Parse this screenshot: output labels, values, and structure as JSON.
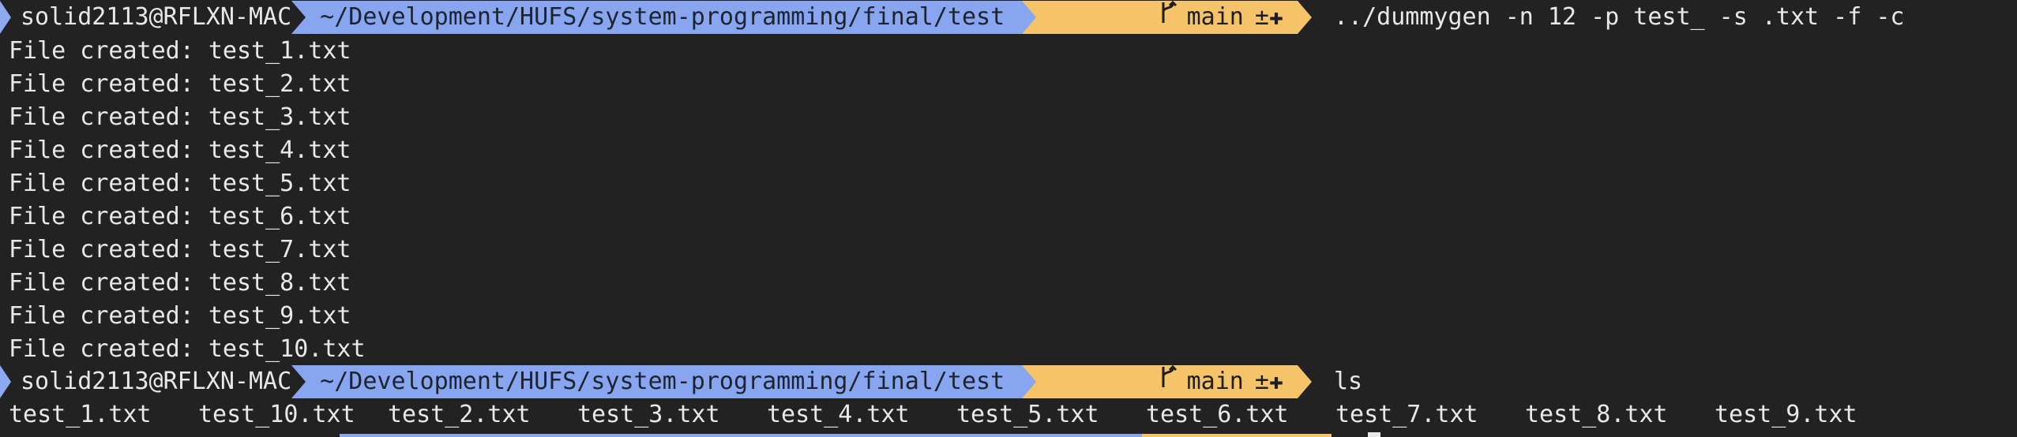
{
  "prompt1": {
    "user_host": "solid2113@RFLXN-MAC",
    "path": "~/Development/HUFS/system-programming/final/test",
    "branch_icon": "branch-icon",
    "branch": "main",
    "git_status": "±✚",
    "command": "../dummygen -n 12 -p test_ -s .txt -f -c"
  },
  "output_lines": [
    "File created: test_1.txt",
    "File created: test_2.txt",
    "File created: test_3.txt",
    "File created: test_4.txt",
    "File created: test_5.txt",
    "File created: test_6.txt",
    "File created: test_7.txt",
    "File created: test_8.txt",
    "File created: test_9.txt",
    "File created: test_10.txt"
  ],
  "prompt2": {
    "user_host": "solid2113@RFLXN-MAC",
    "path": "~/Development/HUFS/system-programming/final/test",
    "branch": "main",
    "git_status": "±✚",
    "command": "ls"
  },
  "ls_output": [
    "test_1.txt",
    "test_10.txt",
    "test_2.txt",
    "test_3.txt",
    "test_4.txt",
    "test_5.txt",
    "test_6.txt",
    "test_7.txt",
    "test_8.txt",
    "test_9.txt"
  ],
  "colors": {
    "background": "#222222",
    "path_segment": "#88a5f0",
    "git_segment": "#f5c46a",
    "text": "#e8e8e8"
  }
}
